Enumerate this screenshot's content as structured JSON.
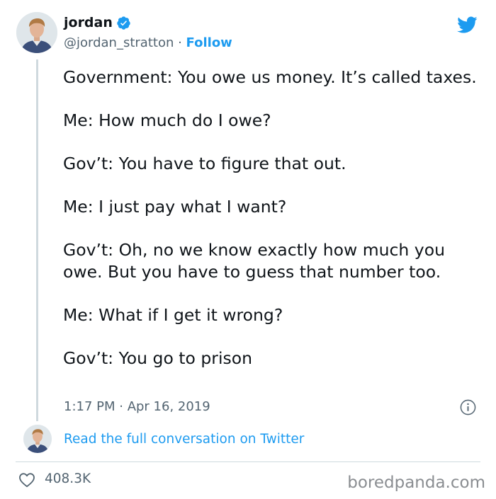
{
  "author": {
    "display_name": "jordan",
    "handle": "@jordan_stratton",
    "separator": " · ",
    "follow_label": "Follow",
    "verified": true
  },
  "tweet": {
    "paragraphs": [
      "Government: You owe us money. It’s called taxes.",
      "Me: How much do I owe?",
      "Gov’t: You have to figure that out.",
      "Me: I just pay what I want?",
      "Gov’t: Oh, no we know exactly how much you owe. But you have to guess that number too.",
      "Me: What if I get it wrong?",
      "Gov’t: You go to prison"
    ],
    "timestamp": "1:17 PM · Apr 16, 2019"
  },
  "conversation_link": "Read the full conversation on Twitter",
  "likes": "408.3K",
  "watermark": "boredpanda.com",
  "icons": {
    "verified": "verified-badge-icon",
    "brand": "twitter-bird-icon",
    "info": "info-icon",
    "like": "heart-icon"
  },
  "colors": {
    "accent": "#1d9bf0",
    "secondary_text": "#536471",
    "divider": "#cfd9de"
  }
}
